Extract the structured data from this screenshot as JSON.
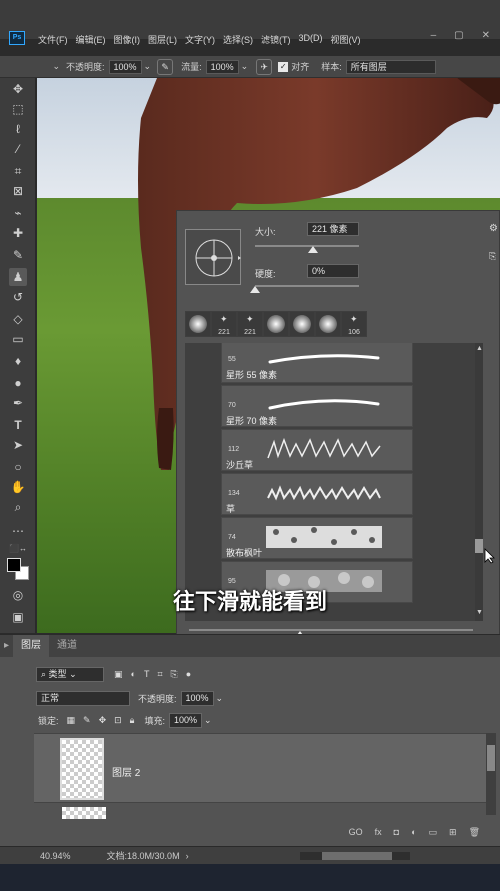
{
  "app": {
    "logo": "Ps"
  },
  "menu": [
    "文件(F)",
    "编辑(E)",
    "图像(I)",
    "图层(L)",
    "文字(Y)",
    "选择(S)",
    "滤镜(T)",
    "3D(D)",
    "视图(V)"
  ],
  "window_controls": [
    "–",
    "▢",
    "✕"
  ],
  "options_bar": {
    "opacity_label": "不透明度:",
    "opacity_value": "100%",
    "flow_label": "流量:",
    "flow_value": "100%",
    "align_label": "对齐",
    "sample_label": "样本:",
    "sample_value": "所有图层"
  },
  "brush_panel": {
    "size_label": "大小:",
    "size_value": "221 像素",
    "hardness_label": "硬度:",
    "hardness_value": "0%",
    "size_level": 0.56,
    "hardness_level": 0.0,
    "recent_brushes": [
      "",
      "221",
      "221",
      "",
      "",
      "",
      "106"
    ],
    "brushes": [
      {
        "size": "55",
        "name": "星形 55 像素"
      },
      {
        "size": "70",
        "name": "星形 70 像素"
      },
      {
        "size": "112",
        "name": "沙丘草"
      },
      {
        "size": "134",
        "name": "草"
      },
      {
        "size": "74",
        "name": "散布枫叶"
      },
      {
        "size": "95",
        "name": ""
      }
    ]
  },
  "subtitle": "往下滑就能看到",
  "layers": {
    "tabs": [
      "图层",
      "通道"
    ],
    "filter_kind": "类型",
    "blend_mode": "正常",
    "opacity_label": "不透明度:",
    "opacity_value": "100%",
    "lock_label": "锁定:",
    "fill_label": "填充:",
    "fill_value": "100%",
    "layer_name": "图层 2"
  },
  "status": {
    "zoom": "40.94%",
    "doc": "文档:18.0M/30.0M"
  }
}
